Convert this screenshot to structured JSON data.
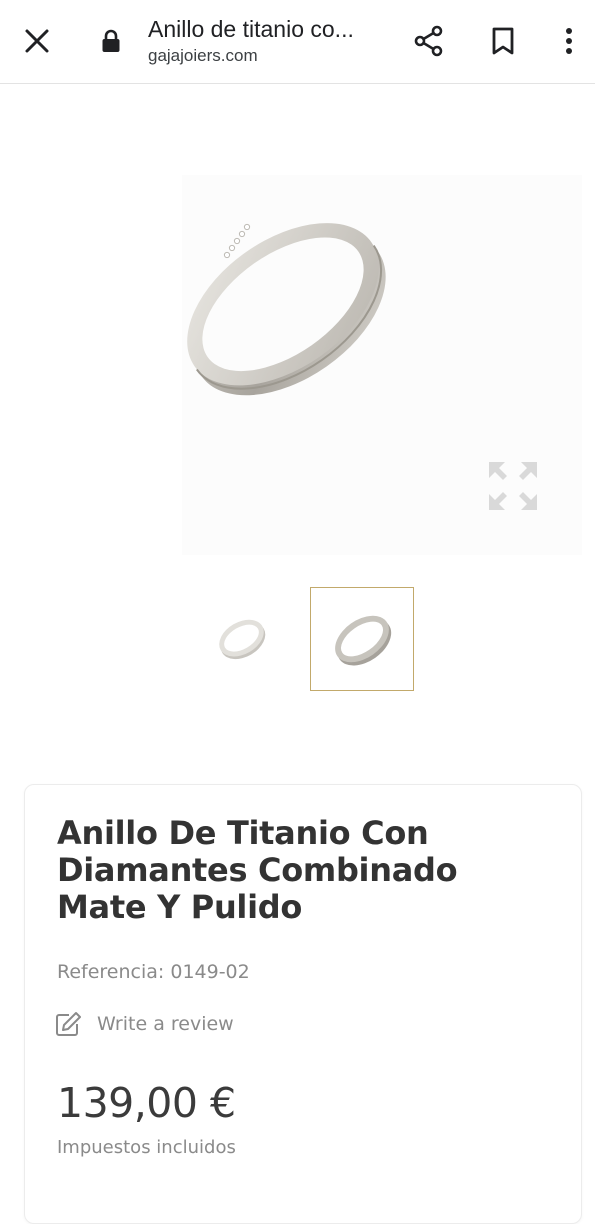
{
  "browser": {
    "page_title": "Anillo de titanio co...",
    "domain": "gajajoiers.com",
    "icons": {
      "close": "close-icon",
      "lock": "lock-icon",
      "share": "share-icon",
      "bookmark": "bookmark-icon",
      "menu": "more-vert-icon"
    }
  },
  "gallery": {
    "selected_thumbnail": 2,
    "thumbnail_border_color": "#c2a96b",
    "expand_icon": "expand-icon"
  },
  "product": {
    "title": "Anillo De Titanio Con Diamantes Combinado Mate Y Pulido",
    "reference": "Referencia: 0149-02",
    "review_label": "Write a review",
    "review_icon": "edit-icon",
    "price": "139,00 €",
    "tax_note": "Impuestos incluidos"
  },
  "colors": {
    "text_dark": "#333333",
    "text_muted": "#8a8a8a",
    "accent_gold": "#c2a96b"
  }
}
